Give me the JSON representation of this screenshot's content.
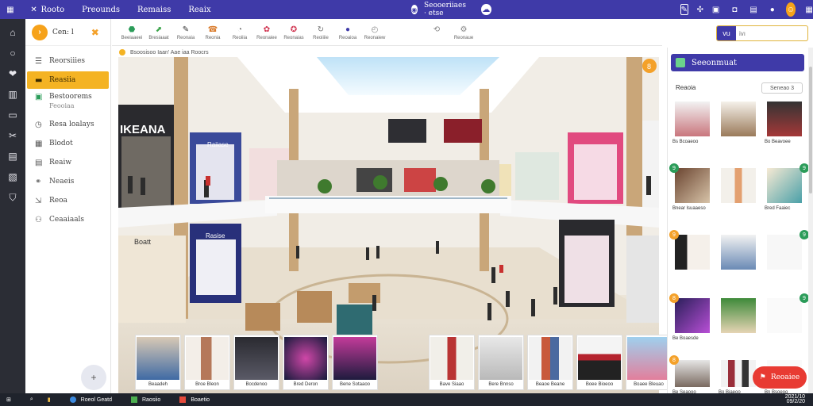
{
  "window": {
    "menu": [
      "Rooto",
      "Preounds",
      "Remaiss",
      "Reaix"
    ],
    "center_title": "Seooeriiaes · etse",
    "colors": {
      "accent": "#3f3aa8",
      "highlight": "#f4b323",
      "cta": "#e83a32",
      "rail": "#2b2d35"
    }
  },
  "topbar_icons": [
    "grid-icon",
    "pin-icon",
    "globe-icon",
    "chat-icon"
  ],
  "right_icons": [
    "clipboard-icon",
    "bell-icon",
    "bag-icon",
    "chat-bubble-icon",
    "camera-icon",
    "avatar-icon",
    "grid-icon"
  ],
  "sidebar": {
    "brand": "Cen: l",
    "items": [
      {
        "label": "Reorsiiies",
        "icon": "list-icon"
      },
      {
        "label": "Reasiia",
        "icon": "folder-icon",
        "active": true
      },
      {
        "label": "Bestoorems",
        "sub": "Feooiaa",
        "icon": "box-icon"
      },
      {
        "label": "Resa loalays",
        "icon": "tag-icon"
      },
      {
        "label": "Blodot",
        "icon": "tile-icon"
      },
      {
        "label": "Reaiw",
        "icon": "doc-icon"
      },
      {
        "label": "Neaeis",
        "icon": "chart-icon"
      },
      {
        "label": "Reoa",
        "icon": "settings-icon"
      },
      {
        "label": "Ceaaiaals",
        "icon": "user-icon"
      }
    ],
    "fab": "+"
  },
  "rail_icons": [
    "home-icon",
    "circle-icon",
    "heart-icon",
    "clipboard-icon",
    "monitor-icon",
    "tools-icon",
    "document-icon",
    "ticket-icon",
    "shield-icon"
  ],
  "toolbar": {
    "buttons": [
      {
        "label": "Beeiaaeei",
        "icon": "layers-icon",
        "color": "#2b9c59"
      },
      {
        "label": "Bresiaaat",
        "icon": "upload-icon",
        "color": "#3ba44a"
      },
      {
        "label": "Reonaia",
        "icon": "pen-icon",
        "color": "#666"
      },
      {
        "label": "Reonia",
        "icon": "phone-icon",
        "color": "#d97a2a"
      },
      {
        "label": "Reoiiia",
        "icon": "clock-icon",
        "color": "#777"
      },
      {
        "label": "Reonaiee",
        "icon": "flower-icon",
        "color": "#d0334f"
      },
      {
        "label": "Reonaias",
        "icon": "badge-icon",
        "color": "#d0334f"
      },
      {
        "label": "Reoiiiie",
        "icon": "refresh-icon",
        "color": "#777"
      },
      {
        "label": "Reoaioa",
        "icon": "dot-icon",
        "color": "#3f3aa8"
      },
      {
        "label": "Reonaiew",
        "icon": "timer-icon",
        "color": "#888"
      },
      {
        "label": "",
        "icon": "link-icon",
        "color": "#888"
      },
      {
        "label": "Reonaue",
        "icon": "gear-icon",
        "color": "#888"
      }
    ]
  },
  "search": {
    "placeholder": "ivı",
    "button": "vu"
  },
  "breadcrumb": "Bsoosisoo Iaan' Aae iaa Roocrs",
  "scene": {
    "store_signs": [
      "IKEANA",
      "Raiiase",
      "Boatt",
      "Rasise"
    ],
    "corner_badge": "8"
  },
  "thumbnails": [
    {
      "caption": "Beaadeh"
    },
    {
      "caption": "Broe Bleon"
    },
    {
      "caption": "Bocdenoo"
    },
    {
      "caption": "Bred Deron"
    },
    {
      "caption": "Bene Sotaaoo"
    },
    {
      "caption": "Bave Siaao"
    },
    {
      "caption": "Bere Bnnso"
    },
    {
      "caption": "Beaoe Beane"
    },
    {
      "caption": "Boee Bioeoo"
    },
    {
      "caption": "Boaee Bleuao"
    }
  ],
  "panel": {
    "title": "Seeonmuat",
    "subtitle": "Reaoia",
    "sort_button": "Seneao 3",
    "rows": [
      [
        {
          "caption": "Bs Bcoaeoo"
        },
        {
          "caption": ""
        },
        {
          "caption": "Bo Beavoee"
        }
      ],
      [
        {
          "caption": "Bnear lsuaaeso",
          "badge": "9"
        },
        {
          "caption": ""
        },
        {
          "caption": "Bred Faaiec",
          "badge": "9"
        }
      ],
      [
        {
          "caption": "",
          "badge": "9"
        },
        {
          "caption": ""
        },
        {
          "caption": "",
          "badge": "9"
        }
      ],
      [
        {
          "caption": "Be Boaesde",
          "badge": "8"
        },
        {
          "caption": ""
        },
        {
          "caption": "",
          "badge": "9"
        }
      ],
      [
        {
          "caption": "Be Seaooo",
          "badge": "8"
        },
        {
          "caption": "Bo Biaeoo"
        },
        {
          "caption": "Bn Bsoeoo"
        }
      ]
    ],
    "cta": "Reoaiee"
  },
  "taskbar": {
    "apps": [
      {
        "label": "",
        "icon": "windows-icon"
      },
      {
        "label": "",
        "icon": "search-icon"
      },
      {
        "label": "",
        "icon": "folder-icon"
      },
      {
        "label": "Roeol Geatd",
        "icon": "browser-icon"
      },
      {
        "label": "Raosiio",
        "icon": "photos-icon"
      },
      {
        "label": "Boaetio",
        "icon": "app-icon"
      }
    ],
    "time": "2021/10",
    "date": "09/2/20"
  }
}
